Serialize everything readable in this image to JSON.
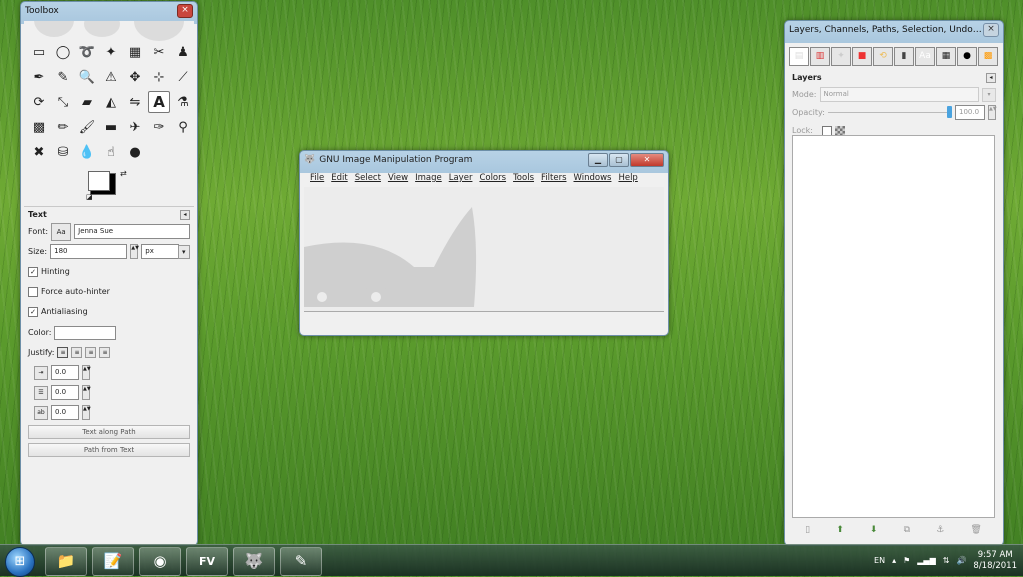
{
  "toolbox": {
    "title": "Toolbox",
    "tools": [
      {
        "name": "rect-select-icon",
        "glyph": "▭"
      },
      {
        "name": "ellipse-select-icon",
        "glyph": "◯"
      },
      {
        "name": "free-select-icon",
        "glyph": "➰"
      },
      {
        "name": "fuzzy-select-icon",
        "glyph": "✦"
      },
      {
        "name": "color-select-icon",
        "glyph": "▦"
      },
      {
        "name": "scissors-icon",
        "glyph": "✂"
      },
      {
        "name": "foreground-select-icon",
        "glyph": "♟"
      },
      {
        "name": "paths-icon",
        "glyph": "✒"
      },
      {
        "name": "color-picker-icon",
        "glyph": "✎"
      },
      {
        "name": "zoom-icon",
        "glyph": "🔍"
      },
      {
        "name": "measure-icon",
        "glyph": "⚠"
      },
      {
        "name": "move-icon",
        "glyph": "✥"
      },
      {
        "name": "align-icon",
        "glyph": "⊹"
      },
      {
        "name": "crop-icon",
        "glyph": "⟋"
      },
      {
        "name": "rotate-icon",
        "glyph": "⟳"
      },
      {
        "name": "scale-icon",
        "glyph": "⤡"
      },
      {
        "name": "shear-icon",
        "glyph": "▰"
      },
      {
        "name": "perspective-icon",
        "glyph": "◭"
      },
      {
        "name": "flip-icon",
        "glyph": "⇋"
      },
      {
        "name": "text-icon",
        "glyph": "A"
      },
      {
        "name": "bucket-fill-icon",
        "glyph": "⚗"
      },
      {
        "name": "blend-icon",
        "glyph": "▩"
      },
      {
        "name": "pencil-icon",
        "glyph": "✏"
      },
      {
        "name": "paintbrush-icon",
        "glyph": "🖌"
      },
      {
        "name": "eraser-icon",
        "glyph": "▬"
      },
      {
        "name": "airbrush-icon",
        "glyph": "✈"
      },
      {
        "name": "ink-icon",
        "glyph": "✑"
      },
      {
        "name": "clone-icon",
        "glyph": "⚲"
      },
      {
        "name": "heal-icon",
        "glyph": "✖"
      },
      {
        "name": "perspective-clone-icon",
        "glyph": "⛁"
      },
      {
        "name": "blur-icon",
        "glyph": "💧"
      },
      {
        "name": "smudge-icon",
        "glyph": "☝"
      },
      {
        "name": "dodge-burn-icon",
        "glyph": "●"
      }
    ],
    "active_tool": "text-icon",
    "options": {
      "heading": "Text",
      "font_label": "Font:",
      "font_value": "Jenna Sue",
      "size_label": "Size:",
      "size_value": "180",
      "size_unit": "px",
      "hinting_label": "Hinting",
      "hinting_checked": true,
      "autohinter_label": "Force auto-hinter",
      "autohinter_checked": false,
      "antialias_label": "Antialiasing",
      "antialias_checked": true,
      "color_label": "Color:",
      "justify_label": "Justify:",
      "indent_value": "0.0",
      "line_spacing_value": "0.0",
      "letter_spacing_value": "0.0",
      "text_along_path": "Text along Path",
      "path_from_text": "Path from Text"
    }
  },
  "gimp_window": {
    "title": "GNU Image Manipulation Program",
    "menu": [
      "File",
      "Edit",
      "Select",
      "View",
      "Image",
      "Layer",
      "Colors",
      "Tools",
      "Filters",
      "Windows",
      "Help"
    ]
  },
  "layers_dock": {
    "title": "Layers, Channels, Paths, Selection, Undo, Gradie...",
    "tab_icons": [
      "layers-tab-icon",
      "channels-tab-icon",
      "paths-tab-icon",
      "selection-tab-icon",
      "undo-tab-icon",
      "gradients-tab-icon",
      "fonts-tab-icon",
      "palettes-tab-icon",
      "brushes-tab-icon",
      "patterns-tab-icon"
    ],
    "heading": "Layers",
    "mode_label": "Mode:",
    "mode_value": "Normal",
    "opacity_label": "Opacity:",
    "opacity_value": "100.0",
    "lock_label": "Lock:"
  },
  "taskbar": {
    "apps": [
      {
        "name": "explorer-taskbar-icon",
        "glyph": "📁"
      },
      {
        "name": "notepad-taskbar-icon",
        "glyph": "📝"
      },
      {
        "name": "chrome-taskbar-icon",
        "glyph": "◉"
      },
      {
        "name": "fontviewer-taskbar-icon",
        "glyph": "FV"
      },
      {
        "name": "gimp-taskbar-icon",
        "glyph": "🐺"
      },
      {
        "name": "tool-taskbar-icon",
        "glyph": "✎"
      }
    ],
    "language": "EN",
    "time": "9:57 AM",
    "date": "8/18/2011"
  }
}
